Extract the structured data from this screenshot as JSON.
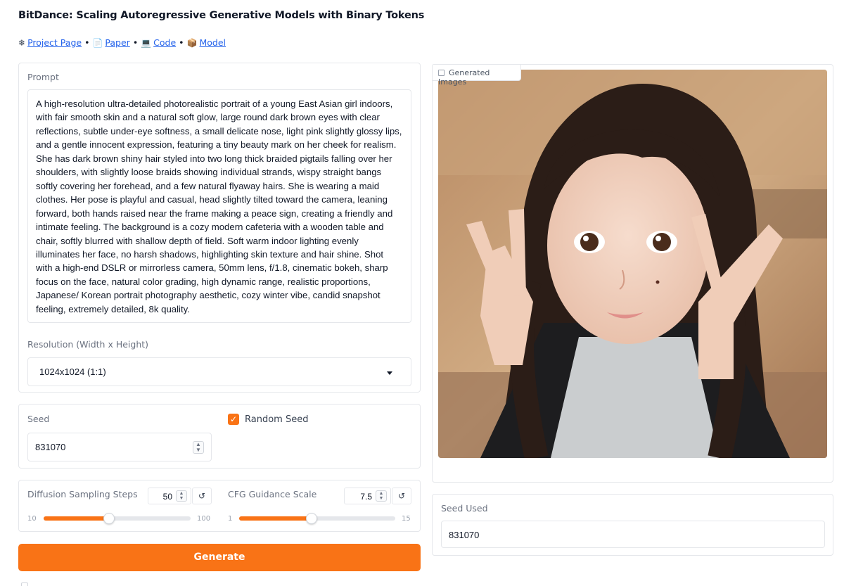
{
  "page": {
    "title": "BitDance: Scaling Autoregressive Generative Models with Binary Tokens",
    "links": [
      {
        "label": "Project Page",
        "icon": "sparkle-icon",
        "glyph": "❄"
      },
      {
        "label": "Paper",
        "icon": "document-icon",
        "glyph": "📄"
      },
      {
        "label": "Code",
        "icon": "laptop-icon",
        "glyph": "💻"
      },
      {
        "label": "Model",
        "icon": "package-icon",
        "glyph": "📦"
      }
    ],
    "separator": "•"
  },
  "prompt": {
    "label": "Prompt",
    "text": "A high-resolution ultra-detailed photorealistic portrait of a young East Asian girl indoors, with fair smooth skin and a natural soft glow, large round dark brown eyes with clear reflections, subtle under-eye softness, a small delicate nose, light pink slightly glossy lips, and a gentle innocent expression, featuring a tiny beauty mark on her cheek for realism. She has dark brown shiny hair styled into two long thick braided pigtails falling over her shoulders, with slightly loose braids showing individual strands, wispy straight bangs softly covering her forehead, and a few natural flyaway hairs. She is wearing a maid clothes. Her pose is playful and casual, head slightly tilted toward the camera, leaning forward, both hands raised near the frame making a peace sign, creating a friendly and intimate feeling. The background is a cozy modern cafeteria with a wooden table and chair, softly blurred with shallow depth of field. Soft warm indoor lighting evenly illuminates her face, no harsh shadows, highlighting skin texture and hair shine. Shot with a high-end DSLR or mirrorless camera, 50mm lens, f/1.8, cinematic bokeh, sharp focus on the face, natural color grading, high dynamic range, realistic proportions, Japanese/ Korean portrait photography aesthetic, cozy winter vibe, candid snapshot feeling, extremely detailed, 8k quality."
  },
  "resolution": {
    "label": "Resolution (Width x Height)",
    "selected": "1024x1024 (1:1)"
  },
  "seed": {
    "label": "Seed",
    "value": "831070",
    "random_label": "Random Seed",
    "random_checked": true
  },
  "steps": {
    "label": "Diffusion Sampling Steps",
    "value": "50",
    "min": "10",
    "max": "100",
    "fraction": 0.444
  },
  "cfg": {
    "label": "CFG Guidance Scale",
    "value": "7.5",
    "min": "1",
    "max": "15",
    "fraction": 0.464
  },
  "generate": {
    "label": "Generate"
  },
  "gallery": {
    "label": "Generated Images",
    "icon": "image-icon"
  },
  "seed_used": {
    "label": "Seed Used",
    "value": "831070"
  },
  "colors": {
    "accent": "#f97316",
    "link": "#2563eb",
    "border": "#e5e7eb"
  }
}
